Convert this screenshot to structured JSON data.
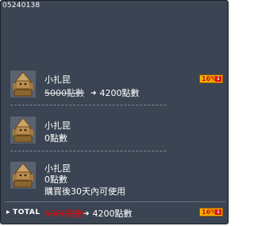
{
  "item_id": "05240138",
  "items": [
    {
      "name": "小扎昆",
      "price_original": "5000點數",
      "price_final": "4200點數",
      "discount_badge": "16%",
      "note": ""
    },
    {
      "name": "小扎昆",
      "price": "0點數",
      "note": ""
    },
    {
      "name": "小扎昆",
      "price": "0點數",
      "note": "購買後30天內可使用"
    }
  ],
  "total": {
    "label": "TOTAL",
    "original": "5000點數",
    "final": "4200點數",
    "discount_badge": "16%"
  },
  "icons": {
    "arrow": "right-arrow-icon",
    "badge_down": "down-arrow-icon",
    "thumbnail": "zakum-figure-icon"
  },
  "colors": {
    "panel_bg": "#3b4452",
    "badge_bg": "#f6b000",
    "badge_text": "#c01010",
    "strike_red": "#cc1111"
  }
}
